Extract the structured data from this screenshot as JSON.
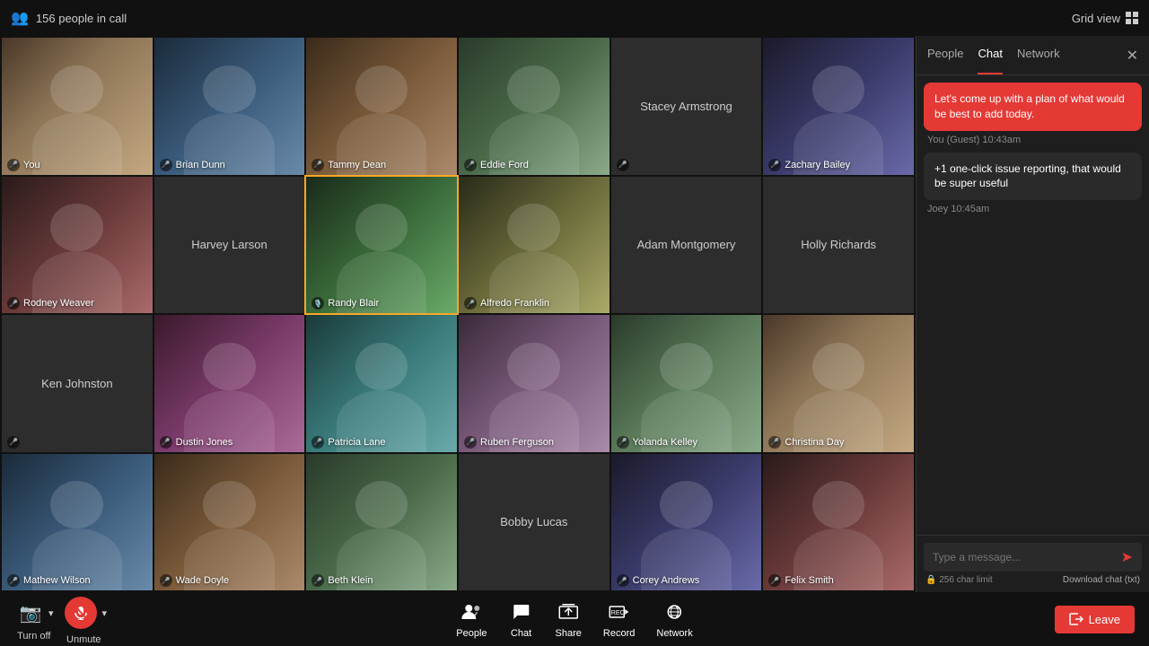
{
  "topBar": {
    "peopleCount": "156 people in call",
    "gridViewLabel": "Grid view"
  },
  "sidebar": {
    "tabs": [
      {
        "id": "people",
        "label": "People",
        "active": false
      },
      {
        "id": "chat",
        "label": "Chat",
        "active": true
      },
      {
        "id": "network",
        "label": "Network",
        "active": false
      }
    ],
    "chat": {
      "messages": [
        {
          "text": "Let's come up with a plan of what would be best to add today.",
          "sender": "You (Guest)",
          "time": "10:43am",
          "isSelf": true
        },
        {
          "text": "+1 one-click issue reporting, that would be super useful",
          "sender": "Joey",
          "time": "10:45am",
          "isSelf": false
        }
      ],
      "inputPlaceholder": "Type a message...",
      "charLimit": "256 char limit",
      "downloadLabel": "Download chat (txt)"
    }
  },
  "participants": [
    {
      "name": "You",
      "hasVideo": true,
      "muted": true,
      "bg": "bg-1"
    },
    {
      "name": "Brian Dunn",
      "hasVideo": true,
      "muted": true,
      "bg": "bg-2"
    },
    {
      "name": "Tammy Dean",
      "hasVideo": true,
      "muted": false,
      "bg": "bg-3"
    },
    {
      "name": "Eddie Ford",
      "hasVideo": true,
      "muted": true,
      "bg": "bg-4"
    },
    {
      "name": "Stacey Armstrong",
      "hasVideo": false,
      "muted": true,
      "bg": ""
    },
    {
      "name": "Zachary Bailey",
      "hasVideo": true,
      "muted": true,
      "bg": "bg-5"
    },
    {
      "name": "Rodney Weaver",
      "hasVideo": true,
      "muted": true,
      "bg": "bg-6"
    },
    {
      "name": "Harvey Larson",
      "hasVideo": false,
      "muted": false,
      "bg": ""
    },
    {
      "name": "Randy Blair",
      "hasVideo": true,
      "muted": false,
      "bg": "bg-7",
      "activeSpeaker": true
    },
    {
      "name": "Alfredo Franklin",
      "hasVideo": true,
      "muted": true,
      "bg": "bg-8"
    },
    {
      "name": "Adam Montgomery",
      "hasVideo": false,
      "muted": true,
      "bg": ""
    },
    {
      "name": "Holly Richards",
      "hasVideo": false,
      "muted": true,
      "bg": ""
    },
    {
      "name": "Ken Johnston",
      "hasVideo": false,
      "muted": true,
      "bg": ""
    },
    {
      "name": "Dustin Jones",
      "hasVideo": true,
      "muted": true,
      "bg": "bg-9"
    },
    {
      "name": "Patricia Lane",
      "hasVideo": true,
      "muted": true,
      "bg": "bg-10"
    },
    {
      "name": "Ruben Ferguson",
      "hasVideo": true,
      "muted": true,
      "bg": "bg-11"
    },
    {
      "name": "Yolanda Kelley",
      "hasVideo": true,
      "muted": true,
      "bg": "bg-12"
    },
    {
      "name": "Christina Day",
      "hasVideo": true,
      "muted": true,
      "bg": "bg-1"
    },
    {
      "name": "Mathew Wilson",
      "hasVideo": true,
      "muted": true,
      "bg": "bg-2"
    },
    {
      "name": "Wade Doyle",
      "hasVideo": true,
      "muted": true,
      "bg": "bg-3"
    },
    {
      "name": "Beth Klein",
      "hasVideo": true,
      "muted": true,
      "bg": "bg-4"
    },
    {
      "name": "Bobby Lucas",
      "hasVideo": false,
      "muted": true,
      "bg": ""
    },
    {
      "name": "Corey Andrews",
      "hasVideo": true,
      "muted": true,
      "bg": "bg-5"
    },
    {
      "name": "Felix Smith",
      "hasVideo": true,
      "muted": true,
      "bg": "bg-6"
    }
  ],
  "bottomBar": {
    "turnOffLabel": "Turn off",
    "unmuteLabel": "Unmute",
    "peopleLabel": "People",
    "chatLabel": "Chat",
    "shareLabel": "Share",
    "recordLabel": "Record",
    "networkLabel": "Network",
    "leaveLabel": "Leave"
  }
}
